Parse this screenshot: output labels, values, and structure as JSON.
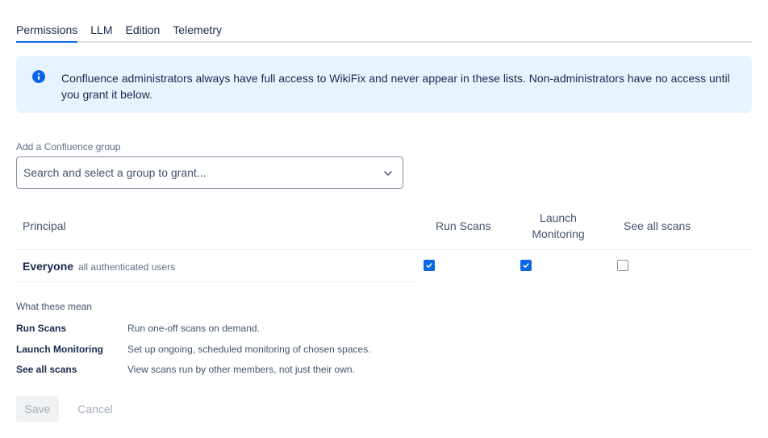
{
  "tabs": [
    {
      "label": "Permissions",
      "active": true
    },
    {
      "label": "LLM",
      "active": false
    },
    {
      "label": "Edition",
      "active": false
    },
    {
      "label": "Telemetry",
      "active": false
    }
  ],
  "banner": {
    "icon": "info-icon",
    "text": "Confluence administrators always have full access to WikiFix and never appear in these lists. Non-administrators have no access until you grant it below."
  },
  "group_picker": {
    "label": "Add a Confluence group",
    "placeholder": "Search and select a group to grant..."
  },
  "table": {
    "columns": {
      "principal": "Principal",
      "run_scans": "Run Scans",
      "launch_monitoring_1": "Launch",
      "launch_monitoring_2": "Monitoring",
      "see_all_scans": "See all scans"
    },
    "rows": [
      {
        "name": "Everyone",
        "description": "all authenticated users",
        "run_scans": true,
        "launch_monitoring": true,
        "see_all_scans": false
      }
    ]
  },
  "legend": {
    "title": "What these mean",
    "items": [
      {
        "term": "Run Scans",
        "description": "Run one-off scans on demand."
      },
      {
        "term": "Launch Monitoring",
        "description": "Set up ongoing, scheduled monitoring of chosen spaces."
      },
      {
        "term": "See all scans",
        "description": "View scans run by other members, not just their own."
      }
    ]
  },
  "actions": {
    "save": "Save",
    "cancel": "Cancel"
  },
  "colors": {
    "accent": "#0c66e4",
    "banner_bg": "#e9f2ff"
  }
}
